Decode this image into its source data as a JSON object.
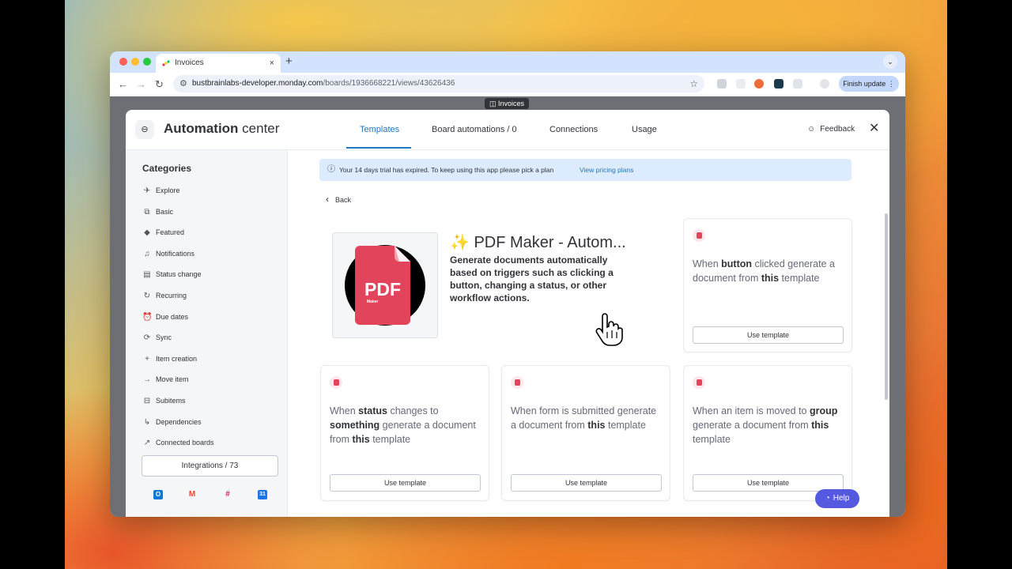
{
  "browser": {
    "tab_title": "Invoices",
    "tab_close": "×",
    "new_tab": "+",
    "url_host": "bustbrainlabs-developer.monday.com",
    "url_path": "/boards/1936668221/views/43626436",
    "finish_update": "Finish update ⋮"
  },
  "view_chip": "◫ Invoices",
  "header": {
    "title_bold": "Automation",
    "title_rest": " center",
    "tabs": [
      {
        "label": "Templates"
      },
      {
        "label": "Board automations / 0"
      },
      {
        "label": "Connections"
      },
      {
        "label": "Usage"
      }
    ],
    "feedback": "Feedback",
    "close": "✕"
  },
  "sidebar": {
    "title": "Categories",
    "items": [
      {
        "label": "Explore",
        "icon": "rocket-icon",
        "glyph": "✈"
      },
      {
        "label": "Basic",
        "icon": "blocks-icon",
        "glyph": "⧉"
      },
      {
        "label": "Featured",
        "icon": "diamond-icon",
        "glyph": "◆"
      },
      {
        "label": "Notifications",
        "icon": "bell-icon",
        "glyph": "♫"
      },
      {
        "label": "Status change",
        "icon": "status-icon",
        "glyph": "▤"
      },
      {
        "label": "Recurring",
        "icon": "recurring-icon",
        "glyph": "↻"
      },
      {
        "label": "Due dates",
        "icon": "alarm-icon",
        "glyph": "⏰"
      },
      {
        "label": "Sync",
        "icon": "sync-icon",
        "glyph": "⟳"
      },
      {
        "label": "Item creation",
        "icon": "plus-icon",
        "glyph": "+"
      },
      {
        "label": "Move item",
        "icon": "arrow-right-icon",
        "glyph": "→"
      },
      {
        "label": "Subitems",
        "icon": "subitems-icon",
        "glyph": "⊟"
      },
      {
        "label": "Dependencies",
        "icon": "dependencies-icon",
        "glyph": "↳"
      },
      {
        "label": "Connected boards",
        "icon": "connected-boards-icon",
        "glyph": "↗"
      }
    ],
    "integrations": "Integrations / 73"
  },
  "banner": {
    "text": "Your 14 days trial has expired. To keep using this app please pick a plan",
    "link": "View pricing plans"
  },
  "back": "Back",
  "app": {
    "title": "✨ PDF Maker - Autom...",
    "description": "Generate documents automatically based on triggers such as clicking a button, changing a status, or other workflow actions.",
    "logo_text": "PDF",
    "logo_sub": "Maker"
  },
  "templates": [
    {
      "parts": [
        "When ",
        "button",
        " clicked generate a document from ",
        "this",
        " template"
      ],
      "button": "Use template"
    },
    {
      "parts": [
        "When ",
        "status",
        " changes to ",
        "something",
        " generate a document from ",
        "this",
        " template"
      ],
      "button": "Use template"
    },
    {
      "parts": [
        "When form is submitted generate a document from ",
        "this",
        " template"
      ],
      "button": "Use template"
    },
    {
      "parts": [
        "When an item is moved to ",
        "group",
        " generate a document from ",
        "this",
        " template"
      ],
      "button": "Use template"
    }
  ],
  "help": "Help",
  "colors": {
    "accent": "#1f76c2",
    "help": "#5559df",
    "pdf_red": "#e2445c",
    "banner": "#dcebfe"
  }
}
